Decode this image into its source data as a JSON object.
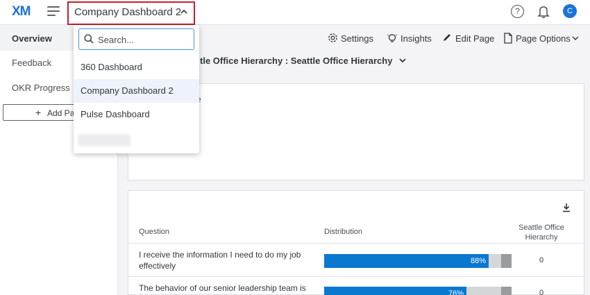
{
  "app": {
    "logo": "XM",
    "avatar_initial": "C"
  },
  "header": {
    "dashboard_name": "Company Dashboard 2",
    "help_glyph": "?"
  },
  "sidebar": {
    "items": [
      {
        "label": "Overview",
        "active": true
      },
      {
        "label": "Feedback",
        "active": false
      },
      {
        "label": "OKR Progress",
        "active": false
      }
    ],
    "add_page_label": "Add Pa"
  },
  "toolbar": {
    "settings_label": "Settings",
    "insights_label": "Insights",
    "edit_page_label": "Edit Page",
    "page_options_label": "Page Options"
  },
  "filter": {
    "hierarchy_label": "tle Office Hierarchy :  Seattle Office Hierarchy"
  },
  "widget1": {
    "partial_text": "e"
  },
  "table": {
    "columns": {
      "question": "Question",
      "distribution": "Distribution",
      "hierarchy": "Seattle Office Hierarchy"
    },
    "rows": [
      {
        "question": "I receive the information I need to do my job effectively",
        "percent_label": "88%",
        "count": "0"
      },
      {
        "question": "The behavior of our senior leadership team is",
        "percent_label": "76%",
        "count": "0"
      }
    ]
  },
  "dropdown": {
    "search_placeholder": "Search...",
    "items": [
      {
        "label": "360 Dashboard",
        "selected": false
      },
      {
        "label": "Company Dashboard 2",
        "selected": true
      },
      {
        "label": "Pulse Dashboard",
        "selected": false
      }
    ]
  },
  "colors": {
    "brand_blue": "#1a73d9",
    "bar_blue": "#0b78d0",
    "bar_light_gray": "#d5d6d8",
    "bar_dark_gray": "#9a9b9d",
    "highlight_border": "#c0202e"
  }
}
